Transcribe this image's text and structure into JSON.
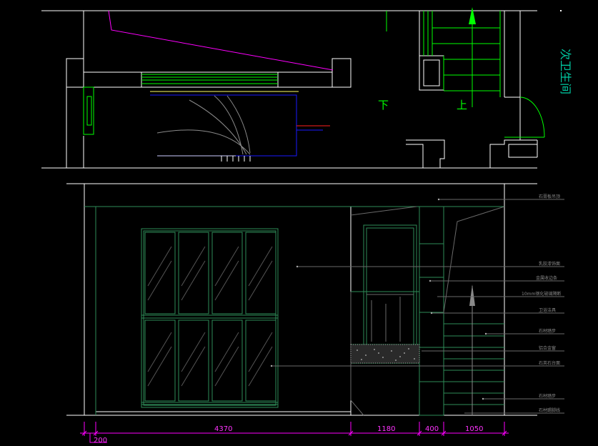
{
  "plan": {
    "room_title": "次卫生间",
    "stair_down": "下",
    "stair_up": "上"
  },
  "elevation": {
    "dimensions": [
      "200",
      "4370",
      "1180",
      "400",
      "1050"
    ],
    "annotations": [
      "石膏板吊顶",
      "乳胶漆饰面",
      "金属收边条",
      "10mm钢化玻璃隔断",
      "卫浴洁具",
      "石材踏步",
      "铝合金窗",
      "石英石台面",
      "石材踏步",
      "石材踢脚线"
    ]
  },
  "colors": {
    "line_white": "#ffffff",
    "line_green": "#00ff00",
    "line_dark_green": "#2e8b57",
    "line_magenta": "#ff00ff",
    "line_blue": "#1a1aff",
    "line_grey": "#8a8a8a",
    "line_yellow": "#ffff66",
    "line_red": "#ff2020"
  }
}
